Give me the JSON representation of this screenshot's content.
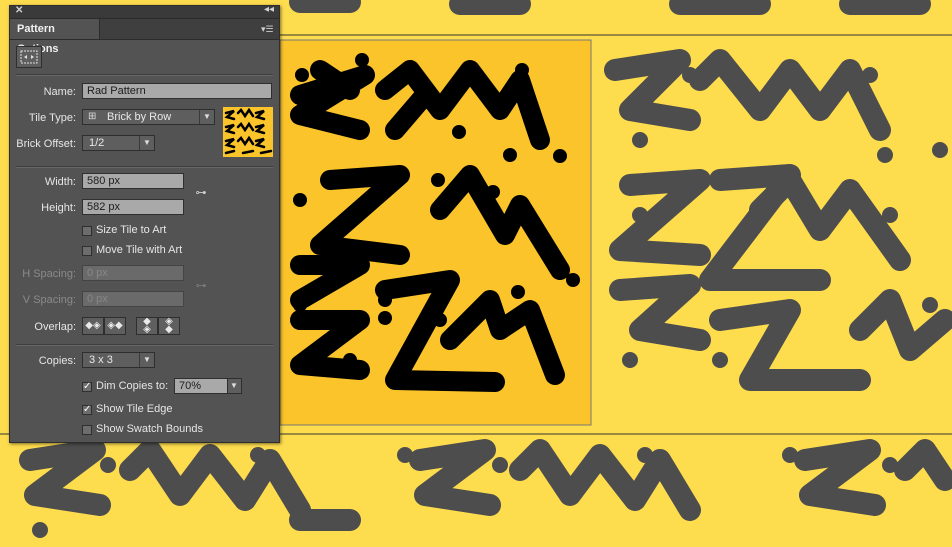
{
  "panel": {
    "title": "Pattern Options",
    "close_icon": "close-icon",
    "collapse_icon": "double-chevron-icon",
    "menu_icon": "panel-menu-icon"
  },
  "tile_tool_icon": "pattern-tile-tool-icon",
  "name": {
    "label": "Name:",
    "value": "Rad Pattern"
  },
  "tile_type": {
    "label": "Tile Type:",
    "value": "Brick by Row",
    "icon": "brick-row-icon"
  },
  "brick_offset": {
    "label": "Brick Offset:",
    "value": "1/2"
  },
  "width": {
    "label": "Width:",
    "value": "580 px"
  },
  "height": {
    "label": "Height:",
    "value": "582 px"
  },
  "size_tile_to_art": {
    "label": "Size Tile to Art",
    "checked": false
  },
  "move_tile_with_art": {
    "label": "Move Tile with Art",
    "checked": false
  },
  "h_spacing": {
    "label": "H Spacing:",
    "value": "0 px"
  },
  "v_spacing": {
    "label": "V Spacing:",
    "value": "0 px"
  },
  "overlap": {
    "label": "Overlap:"
  },
  "copies": {
    "label": "Copies:",
    "value": "3 x 3"
  },
  "dim_copies": {
    "label": "Dim Copies to:",
    "value": "70%",
    "checked": true
  },
  "show_tile_edge": {
    "label": "Show Tile Edge",
    "checked": true
  },
  "show_swatch_bounds": {
    "label": "Show Swatch Bounds",
    "checked": false
  },
  "colors": {
    "background": "#fddc4e",
    "tile": "#fbc42b",
    "ink": "#000000",
    "dim_ink": "#4d4d4d"
  }
}
